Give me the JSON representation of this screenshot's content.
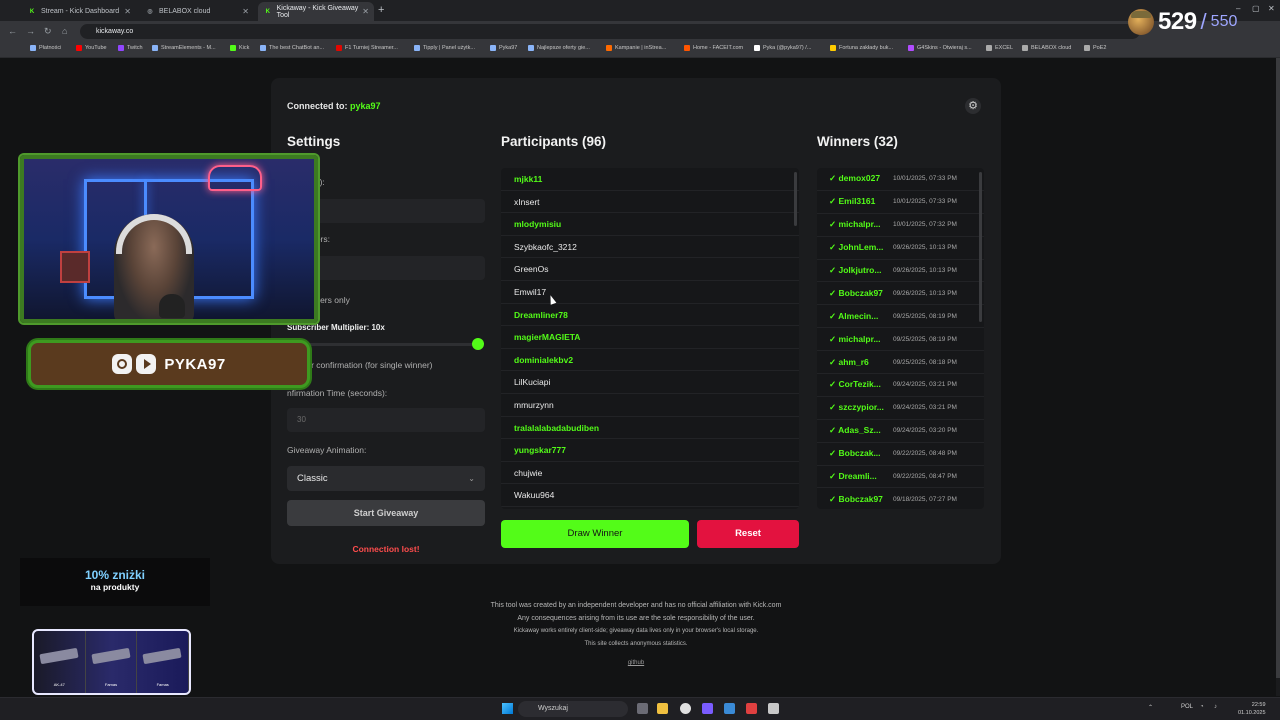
{
  "browser": {
    "tabs": [
      {
        "label": "Stream - Kick Dashboard",
        "fav": "K",
        "fav_color": "#53fc18"
      },
      {
        "label": "BELABOX cloud",
        "fav": "◎",
        "fav_color": "#9aa0a6"
      },
      {
        "label": "Kickaway - Kick Giveaway Tool",
        "fav": "K",
        "fav_color": "#53fc18"
      }
    ],
    "new_tab": "+",
    "url": "kickaway.co",
    "bookmarks": [
      "Płatności",
      "YouTube",
      "Twitch",
      "StreamElements - M...",
      "Kick",
      "The best ChatBot an...",
      "F1 Turniej Streamer...",
      "Tipply | Panel użytk...",
      "Pyka97",
      "Najlepsze oferty gie...",
      "Kampanie | inStrea...",
      "Home - FACEIT.com",
      "Pyka (@pyka97) /...",
      "Fortuna zakłady buk...",
      "G4Skins - Otwieraj s...",
      "EXCEL",
      "BELABOX cloud",
      "PoE2"
    ]
  },
  "overlay_counter": {
    "current": "529",
    "separator": "/",
    "goal": "550"
  },
  "app": {
    "connected_label": "Connected to:",
    "connected_user": "pyka97",
    "settings": {
      "title": "Settings",
      "keyword_label": "(optional):",
      "winners_label": "of Winners:",
      "subs_label": "Subscribers only",
      "multiplier_label": "Subscriber Multiplier: 10x",
      "multiplier_fraction": 1.0,
      "confirm_label": "Winner confirmation (for single winner)",
      "confirm_time_label": "nfirmation Time (seconds):",
      "confirm_time_placeholder": "30",
      "animation_label": "Giveaway Animation:",
      "animation_value": "Classic",
      "start_label": "Start Giveaway",
      "status": "Connection lost!"
    },
    "participants": {
      "title": "Participants (96)",
      "rows": [
        {
          "name": "mjkk11",
          "sub": true
        },
        {
          "name": "xInsert",
          "sub": false
        },
        {
          "name": "mlodymisiu",
          "sub": true
        },
        {
          "name": "Szybkaofc_3212",
          "sub": false
        },
        {
          "name": "GreenOs",
          "sub": false
        },
        {
          "name": "Emwil17",
          "sub": false
        },
        {
          "name": "Dreamliner78",
          "sub": true
        },
        {
          "name": "magierMAGIETA",
          "sub": true
        },
        {
          "name": "dominialekbv2",
          "sub": true
        },
        {
          "name": "LilKuciapi",
          "sub": false
        },
        {
          "name": "mmurzynn",
          "sub": false
        },
        {
          "name": "tralalalabadabudiben",
          "sub": true
        },
        {
          "name": "yungskar777",
          "sub": true
        },
        {
          "name": "chujwie",
          "sub": false
        },
        {
          "name": "Wakuu964",
          "sub": false
        }
      ],
      "draw_label": "Draw Winner",
      "reset_label": "Reset"
    },
    "winners": {
      "title": "Winners (32)",
      "rows": [
        {
          "name": "✓ demox027",
          "date": "10/01/2025, 07:33 PM"
        },
        {
          "name": "✓ Emil3161",
          "date": "10/01/2025, 07:33 PM"
        },
        {
          "name": "✓ michalpr...",
          "date": "10/01/2025, 07:32 PM"
        },
        {
          "name": "✓ JohnLem...",
          "date": "09/26/2025, 10:13 PM"
        },
        {
          "name": "✓ Jolkjutro...",
          "date": "09/26/2025, 10:13 PM"
        },
        {
          "name": "✓ Bobczak97",
          "date": "09/26/2025, 10:13 PM"
        },
        {
          "name": "✓ Almecin...",
          "date": "09/25/2025, 08:19 PM"
        },
        {
          "name": "✓ michalpr...",
          "date": "09/25/2025, 08:19 PM"
        },
        {
          "name": "✓ ahm_r6",
          "date": "09/25/2025, 08:18 PM"
        },
        {
          "name": "✓ CorTezik...",
          "date": "09/24/2025, 03:21 PM"
        },
        {
          "name": "✓ szczypior...",
          "date": "09/24/2025, 03:21 PM"
        },
        {
          "name": "✓ Adas_Sz...",
          "date": "09/24/2025, 03:20 PM"
        },
        {
          "name": "✓ Bobczak...",
          "date": "09/22/2025, 08:48 PM"
        },
        {
          "name": "✓ Dreamli...",
          "date": "09/22/2025, 08:47 PM"
        },
        {
          "name": "✓ Bobczak97",
          "date": "09/18/2025, 07:27 PM"
        }
      ]
    },
    "footer": [
      "This tool was created by an independent developer and has no official affiliation with Kick.com",
      "Any consequences arising from its use are the sole responsibility of the user.",
      "Kickaway works entirely client-side; giveaway data lives only in your browser's local storage.",
      "This site collects anonymous statistics."
    ],
    "footer_link": "github"
  },
  "stream_overlay": {
    "social_name": "PYKA97",
    "promo_big": "10% zniżki",
    "promo_small": "na produkty",
    "skins": [
      "AK-47",
      "Famas",
      "Famas"
    ]
  },
  "taskbar": {
    "search": "Wyszukaj",
    "lang": "POL",
    "time": "22:59",
    "date": "01.10.2025"
  },
  "colors": {
    "accent": "#53fc18",
    "danger": "#e3123f",
    "status_error": "#ff4d4d"
  }
}
